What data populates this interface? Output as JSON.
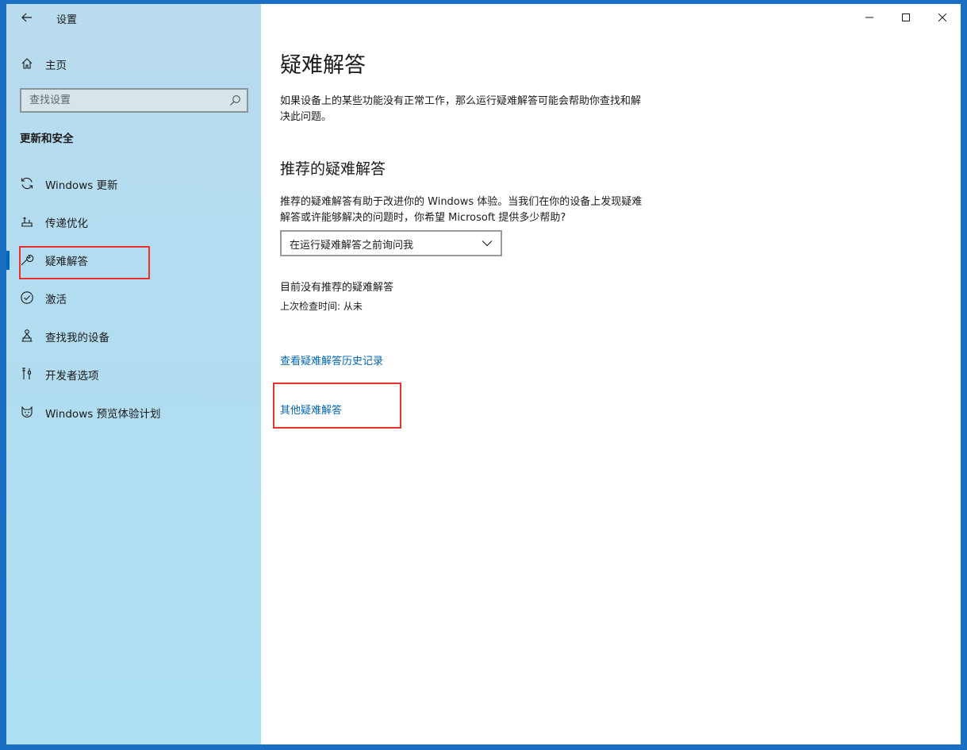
{
  "app": {
    "title": "设置"
  },
  "sidebar": {
    "home_label": "主页",
    "search_placeholder": "查找设置",
    "section_title": "更新和安全",
    "items": [
      {
        "label": "Windows 更新",
        "icon": "refresh-icon"
      },
      {
        "label": "传递优化",
        "icon": "delivery-optimization-icon"
      },
      {
        "label": "疑难解答",
        "icon": "wrench-icon",
        "active": true
      },
      {
        "label": "激活",
        "icon": "check-circle-icon"
      },
      {
        "label": "查找我的设备",
        "icon": "person-location-icon"
      },
      {
        "label": "开发者选项",
        "icon": "developer-tools-icon"
      },
      {
        "label": "Windows 预览体验计划",
        "icon": "insider-cat-icon"
      }
    ]
  },
  "main": {
    "page_title": "疑难解答",
    "intro": "如果设备上的某些功能没有正常工作，那么运行疑难解答可能会帮助你查找和解决此问题。",
    "recommended_title": "推荐的疑难解答",
    "recommended_desc": "推荐的疑难解答有助于改进你的 Windows 体验。当我们在你的设备上发现疑难解答或许能够解决的问题时，你希望 Microsoft 提供多少帮助?",
    "dropdown_value": "在运行疑难解答之前询问我",
    "status": "目前没有推荐的疑难解答",
    "last_check": "上次检查时间: 从未",
    "history_link": "查看疑难解答历史记录",
    "other_link": "其他疑难解答"
  },
  "colors": {
    "accent": "#0067c0",
    "link": "#0066b4",
    "highlight": "#e8322b"
  }
}
